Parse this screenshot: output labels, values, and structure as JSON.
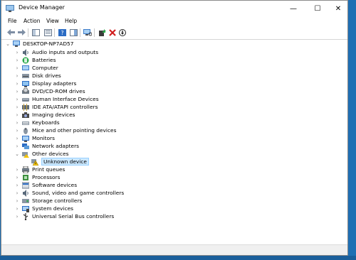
{
  "window": {
    "title": "Device Manager",
    "controls": {
      "minimize": "—",
      "maximize": "☐",
      "close": "✕"
    }
  },
  "menu": [
    "File",
    "Action",
    "View",
    "Help"
  ],
  "toolbar": {
    "buttons": [
      "back-icon",
      "forward-icon",
      "show-hide-console-tree-icon",
      "properties-icon",
      "help-icon",
      "action-pane-icon",
      "scan-hardware-icon",
      "update-driver-icon",
      "uninstall-icon",
      "disable-device-icon"
    ]
  },
  "tree": {
    "root": "DESKTOP-NP7AD57",
    "categories": [
      {
        "label": "Audio inputs and outputs",
        "icon": "speaker-icon"
      },
      {
        "label": "Batteries",
        "icon": "battery-icon"
      },
      {
        "label": "Computer",
        "icon": "computer-icon"
      },
      {
        "label": "Disk drives",
        "icon": "disk-drive-icon"
      },
      {
        "label": "Display adapters",
        "icon": "display-adapter-icon"
      },
      {
        "label": "DVD/CD-ROM drives",
        "icon": "dvd-drive-icon"
      },
      {
        "label": "Human Interface Devices",
        "icon": "hid-icon"
      },
      {
        "label": "IDE ATA/ATAPI controllers",
        "icon": "ide-controller-icon"
      },
      {
        "label": "Imaging devices",
        "icon": "camera-icon"
      },
      {
        "label": "Keyboards",
        "icon": "keyboard-icon"
      },
      {
        "label": "Mice and other pointing devices",
        "icon": "mouse-icon"
      },
      {
        "label": "Monitors",
        "icon": "monitor-icon"
      },
      {
        "label": "Network adapters",
        "icon": "network-adapter-icon"
      },
      {
        "label": "Other devices",
        "icon": "other-devices-icon",
        "expanded": true
      },
      {
        "label": "Unknown device",
        "icon": "warning-device-icon",
        "child": true,
        "selected": true
      },
      {
        "label": "Print queues",
        "icon": "printer-icon"
      },
      {
        "label": "Processors",
        "icon": "processor-icon"
      },
      {
        "label": "Software devices",
        "icon": "software-device-icon"
      },
      {
        "label": "Sound, video and game controllers",
        "icon": "sound-controller-icon"
      },
      {
        "label": "Storage controllers",
        "icon": "storage-controller-icon"
      },
      {
        "label": "System devices",
        "icon": "system-devices-icon"
      },
      {
        "label": "Universal Serial Bus controllers",
        "icon": "usb-icon"
      }
    ]
  },
  "colors": {
    "selection": "#cce8ff",
    "desktop": "#1f6fb3",
    "error": "#d11d1d",
    "warning": "#f2c200"
  }
}
